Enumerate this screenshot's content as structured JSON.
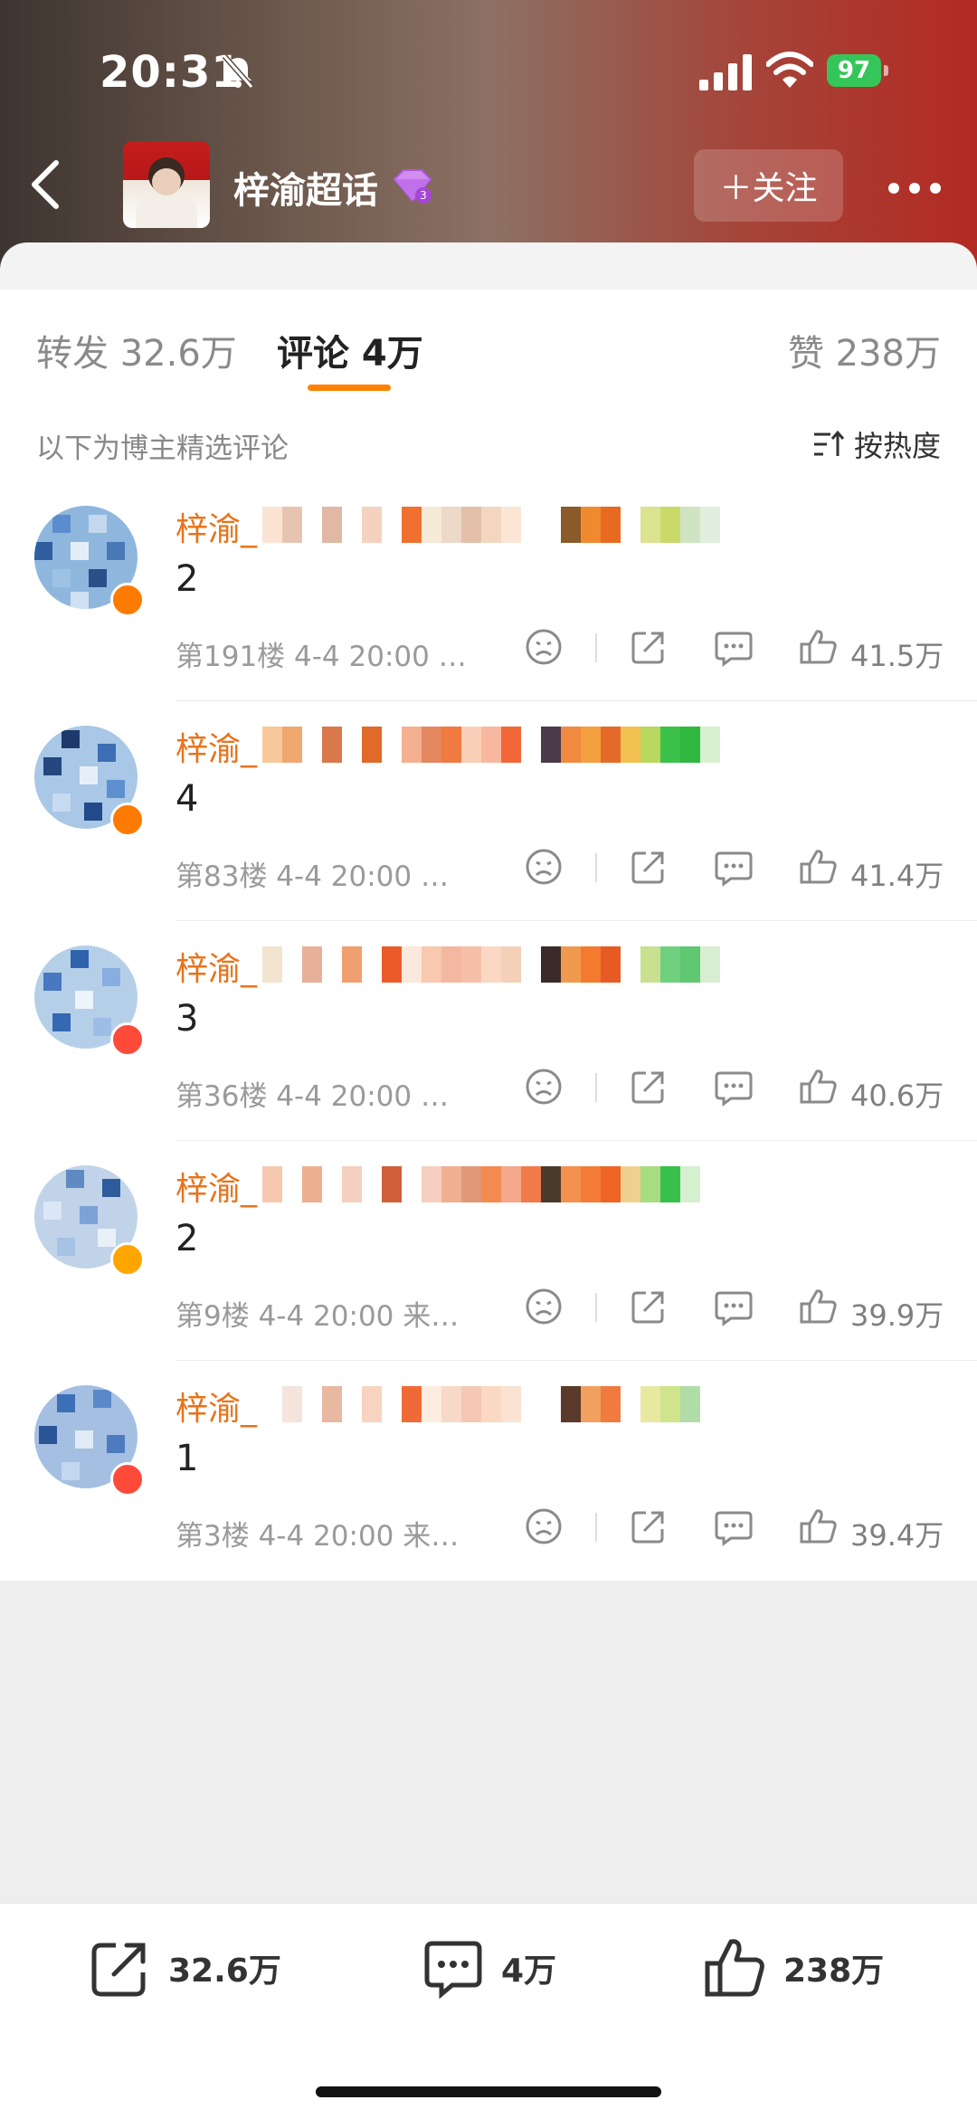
{
  "status_bar": {
    "time": "20:31",
    "battery": "97"
  },
  "nav": {
    "title": "梓渝超话",
    "follow_label": "＋关注"
  },
  "tabs": {
    "repost": "转发 32.6万",
    "comments": "评论 4万",
    "likes": "赞 238万"
  },
  "comments_header": {
    "note": "以下为博主精选评论",
    "sort_label": "按热度"
  },
  "comments": [
    {
      "username": "梓渝_",
      "text": "2",
      "meta": "第191楼 4-4 20:00 …",
      "likes": "41.5万"
    },
    {
      "username": "梓渝_",
      "text": "4",
      "meta": "第83楼 4-4 20:00 …",
      "likes": "41.4万"
    },
    {
      "username": "梓渝_",
      "text": "3",
      "meta": "第36楼 4-4 20:00 …",
      "likes": "40.6万"
    },
    {
      "username": "梓渝_",
      "text": "2",
      "meta": "第9楼 4-4 20:00 来…",
      "likes": "39.9万"
    },
    {
      "username": "梓渝_",
      "text": "1",
      "meta": "第3楼 4-4 20:00 来…",
      "likes": "39.4万"
    }
  ],
  "bottom_bar": {
    "repost": "32.6万",
    "comments": "4万",
    "likes": "238万"
  },
  "colors": {
    "accent": "#ff8200",
    "username": "#e8731a"
  }
}
